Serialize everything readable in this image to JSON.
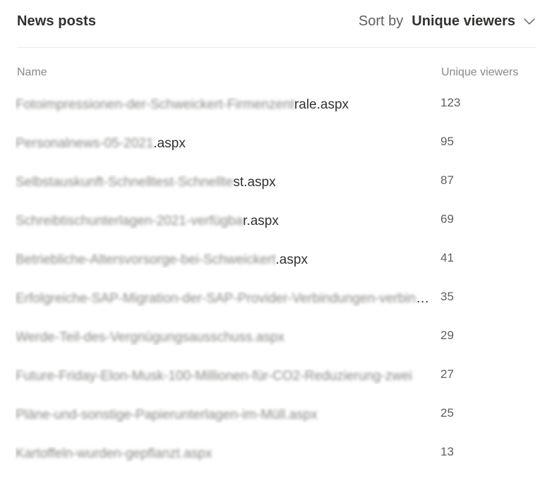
{
  "header": {
    "title": "News posts",
    "sort_label": "Sort by",
    "sort_value": "Unique viewers"
  },
  "columns": {
    "name": "Name",
    "views": "Unique viewers"
  },
  "rows": [
    {
      "name_hidden": "Fotoimpressionen-der-Schweickert-Firmenzent",
      "name_visible": "rale.aspx",
      "views": "123"
    },
    {
      "name_hidden": "Personalnews-05-2021",
      "name_visible": ".aspx",
      "views": "95"
    },
    {
      "name_hidden": "Selbstauskunft-Schnelltest-Schnellte",
      "name_visible": "st.aspx",
      "views": "87"
    },
    {
      "name_hidden": "Schreibtischunterlagen-2021-verfügba",
      "name_visible": "r.aspx",
      "views": "69"
    },
    {
      "name_hidden": "Betriebliche-Altersvorsorge-bei-Schweickert",
      "name_visible": ".aspx",
      "views": "41"
    },
    {
      "name_hidden": "Erfolgreiche-SAP-Migration-der-SAP-Provider-Verbindungen-verbindungen-zwei",
      "name_visible": "",
      "views": "35"
    },
    {
      "name_hidden": "Werde-Teil-des-Vergnügungsausschuss.aspx",
      "name_visible": "",
      "views": "29"
    },
    {
      "name_hidden": "Future-Friday-Elon-Musk-100-Millionen-für-CO2-Reduzierung-zwei",
      "name_visible": "",
      "views": "27"
    },
    {
      "name_hidden": "Pläne-und-sonstige-Papierunterlagen-im-Müll.aspx",
      "name_visible": "",
      "views": "25"
    },
    {
      "name_hidden": "Kartoffeln-wurden-gepflanzt.aspx",
      "name_visible": "",
      "views": "13"
    }
  ]
}
